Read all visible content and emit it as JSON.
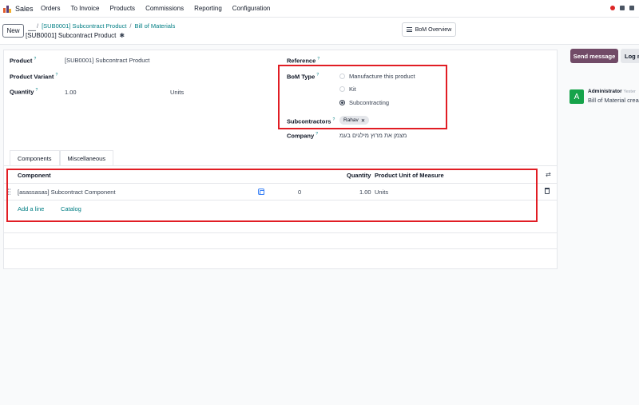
{
  "navbar": {
    "app_name": "Sales",
    "menu": [
      "Orders",
      "To Invoice",
      "Products",
      "Commissions",
      "Reporting",
      "Configuration"
    ]
  },
  "control": {
    "new_label": "New",
    "breadcrumb": [
      "[SUB0001] Subcontract Product",
      "Bill of Materials"
    ],
    "record_name": "[SUB0001] Subcontract Product",
    "bom_overview_label": "BoM Overview"
  },
  "form": {
    "product_label": "Product",
    "product_value": "[SUB0001] Subcontract Product",
    "variant_label": "Product Variant",
    "quantity_label": "Quantity",
    "quantity_value": "1.00",
    "quantity_uom": "Units",
    "reference_label": "Reference",
    "bom_type_label": "BoM Type",
    "bom_type_options": [
      "Manufacture this product",
      "Kit",
      "Subcontracting"
    ],
    "bom_type_selected": "Subcontracting",
    "subcontractors_label": "Subcontractors",
    "subcontractor_tag": "Rahav",
    "company_label": "Company",
    "company_value": "מצמן את מרוץ מילגים בעמ"
  },
  "tabs": [
    "Components",
    "Miscellaneous"
  ],
  "table": {
    "headers": [
      "Component",
      "Quantity",
      "Product Unit of Measure"
    ],
    "rows": [
      {
        "component": "[asassasas] Subcontract Component",
        "extra": "0",
        "quantity": "1.00",
        "uom": "Units"
      }
    ],
    "add_line": "Add a line",
    "catalog": "Catalog"
  },
  "chatter": {
    "send_message": "Send message",
    "log_note": "Log n",
    "avatar_letter": "A",
    "author": "Administrator",
    "time": "Yester",
    "body": "Bill of Material crea"
  },
  "colors": {
    "accent": "#714b67",
    "link": "#017e84",
    "highlight": "#e11d24"
  }
}
